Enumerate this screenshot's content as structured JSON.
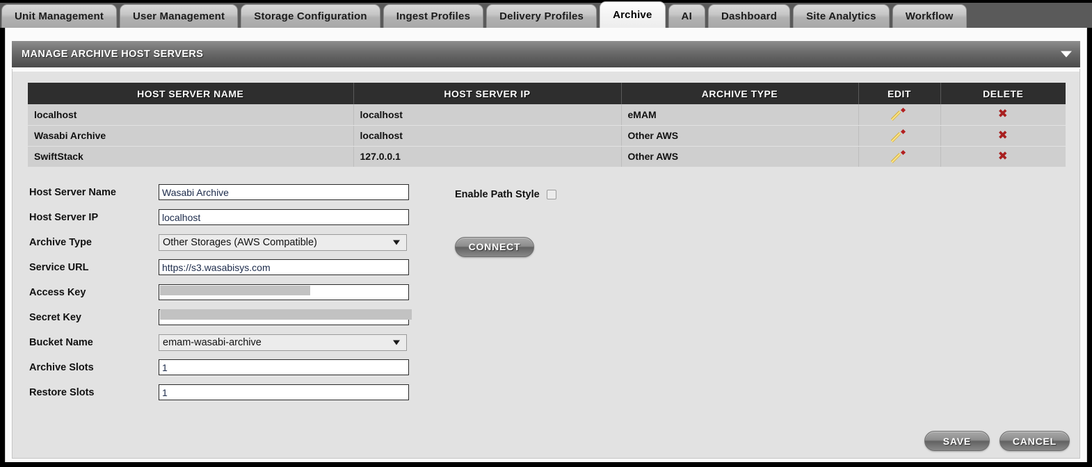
{
  "tabs": [
    {
      "label": "Unit Management",
      "active": false
    },
    {
      "label": "User Management",
      "active": false
    },
    {
      "label": "Storage Configuration",
      "active": false
    },
    {
      "label": "Ingest Profiles",
      "active": false
    },
    {
      "label": "Delivery Profiles",
      "active": false
    },
    {
      "label": "Archive",
      "active": true
    },
    {
      "label": "AI",
      "active": false
    },
    {
      "label": "Dashboard",
      "active": false
    },
    {
      "label": "Site Analytics",
      "active": false
    },
    {
      "label": "Workflow",
      "active": false
    }
  ],
  "panel": {
    "title": "MANAGE ARCHIVE HOST SERVERS",
    "collapse_icon": "chevron-down-icon"
  },
  "table": {
    "columns": [
      "HOST SERVER NAME",
      "HOST SERVER IP",
      "ARCHIVE TYPE",
      "EDIT",
      "DELETE"
    ],
    "rows": [
      {
        "name": "localhost",
        "ip": "localhost",
        "type": "eMAM",
        "edit_icon": "pencil-icon",
        "delete_icon": "x-icon",
        "delete_glyph": "✖"
      },
      {
        "name": "Wasabi Archive",
        "ip": "localhost",
        "type": "Other AWS",
        "edit_icon": "pencil-icon",
        "delete_icon": "x-icon",
        "delete_glyph": "✖"
      },
      {
        "name": "SwiftStack",
        "ip": "127.0.0.1",
        "type": "Other AWS",
        "edit_icon": "pencil-icon",
        "delete_icon": "x-icon",
        "delete_glyph": "✖"
      }
    ]
  },
  "form": {
    "host_server_name": {
      "label": "Host Server Name",
      "value": "Wasabi Archive"
    },
    "host_server_ip": {
      "label": "Host Server IP",
      "value": "localhost"
    },
    "archive_type": {
      "label": "Archive Type",
      "value": "Other Storages (AWS Compatible)"
    },
    "service_url": {
      "label": "Service URL",
      "value": "https://s3.wasabisys.com"
    },
    "access_key": {
      "label": "Access Key",
      "value": ""
    },
    "secret_key": {
      "label": "Secret Key",
      "value": ""
    },
    "bucket_name": {
      "label": "Bucket Name",
      "value": "emam-wasabi-archive"
    },
    "archive_slots": {
      "label": "Archive Slots",
      "value": "1"
    },
    "restore_slots": {
      "label": "Restore Slots",
      "value": "1"
    },
    "enable_path_style": {
      "label": "Enable Path Style",
      "checked": false
    },
    "connect_label": "CONNECT"
  },
  "footer": {
    "save_label": "SAVE",
    "cancel_label": "CANCEL"
  },
  "colors": {
    "tabstrip_bg": "#5a5a5a",
    "panel_header": "#6d6d6d",
    "table_header": "#2e2e2e",
    "row_bg": "#cfcfcf",
    "content_bg": "#e2e2e2",
    "delete_icon": "#a82020",
    "edit_icon": "#e6c341"
  }
}
